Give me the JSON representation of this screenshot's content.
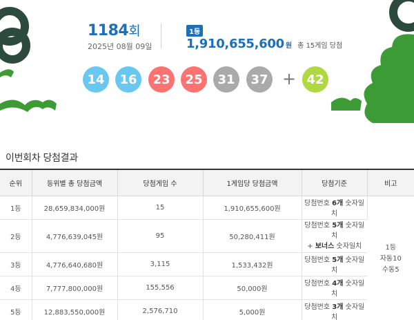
{
  "draw": {
    "round_number": "1184",
    "round_suffix": "회",
    "date": "2025년 08월 09일"
  },
  "first_prize": {
    "badge": "1등",
    "amount": "1,910,655,600",
    "unit": "원",
    "winners": "총 15게임 당첨"
  },
  "balls": [
    {
      "number": "14",
      "color": "#69c8f2"
    },
    {
      "number": "16",
      "color": "#69c8f2"
    },
    {
      "number": "23",
      "color": "#ff7272"
    },
    {
      "number": "25",
      "color": "#ff7272"
    },
    {
      "number": "31",
      "color": "#aaaaaa"
    },
    {
      "number": "37",
      "color": "#aaaaaa"
    }
  ],
  "plus_symbol": "+",
  "bonus_ball": {
    "number": "42",
    "color": "#b0d840"
  },
  "section_title": "이번회차 당첨결과",
  "table": {
    "headers": [
      "순위",
      "등위별 총 당첨금액",
      "당첨게임 수",
      "1게임당 당첨금액",
      "당첨기준",
      "비고"
    ],
    "rows": [
      {
        "rank": "1등",
        "total": "28,659,834,000원",
        "games": "15",
        "per_game": "1,910,655,600원",
        "criteria": [
          "당첨번호 ",
          "6개",
          " 숫자일치"
        ]
      },
      {
        "rank": "2등",
        "total": "4,776,639,045원",
        "games": "95",
        "per_game": "50,280,411원",
        "criteria": [
          "당첨번호 ",
          "5개",
          " 숫자일치"
        ],
        "criteria2": [
          "+ ",
          "보너스",
          " 숫자일치"
        ]
      },
      {
        "rank": "3등",
        "total": "4,776,640,680원",
        "games": "3,115",
        "per_game": "1,533,432원",
        "criteria": [
          "당첨번호 ",
          "5개",
          " 숫자일치"
        ]
      },
      {
        "rank": "4등",
        "total": "7,777,800,000원",
        "games": "155,556",
        "per_game": "50,000원",
        "criteria": [
          "당첨번호 ",
          "4개",
          " 숫자일치"
        ]
      },
      {
        "rank": "5등",
        "total": "12,883,550,000원",
        "games": "2,576,710",
        "per_game": "5,000원",
        "criteria": [
          "당첨번호 ",
          "3개",
          " 숫자일치"
        ]
      }
    ],
    "remark": [
      "1등",
      "자동10",
      "수동5"
    ]
  },
  "colors": {
    "accent": "#1d6fb8",
    "decor_dark_green": "#2d4a3e",
    "decor_green": "#3d9b35"
  }
}
